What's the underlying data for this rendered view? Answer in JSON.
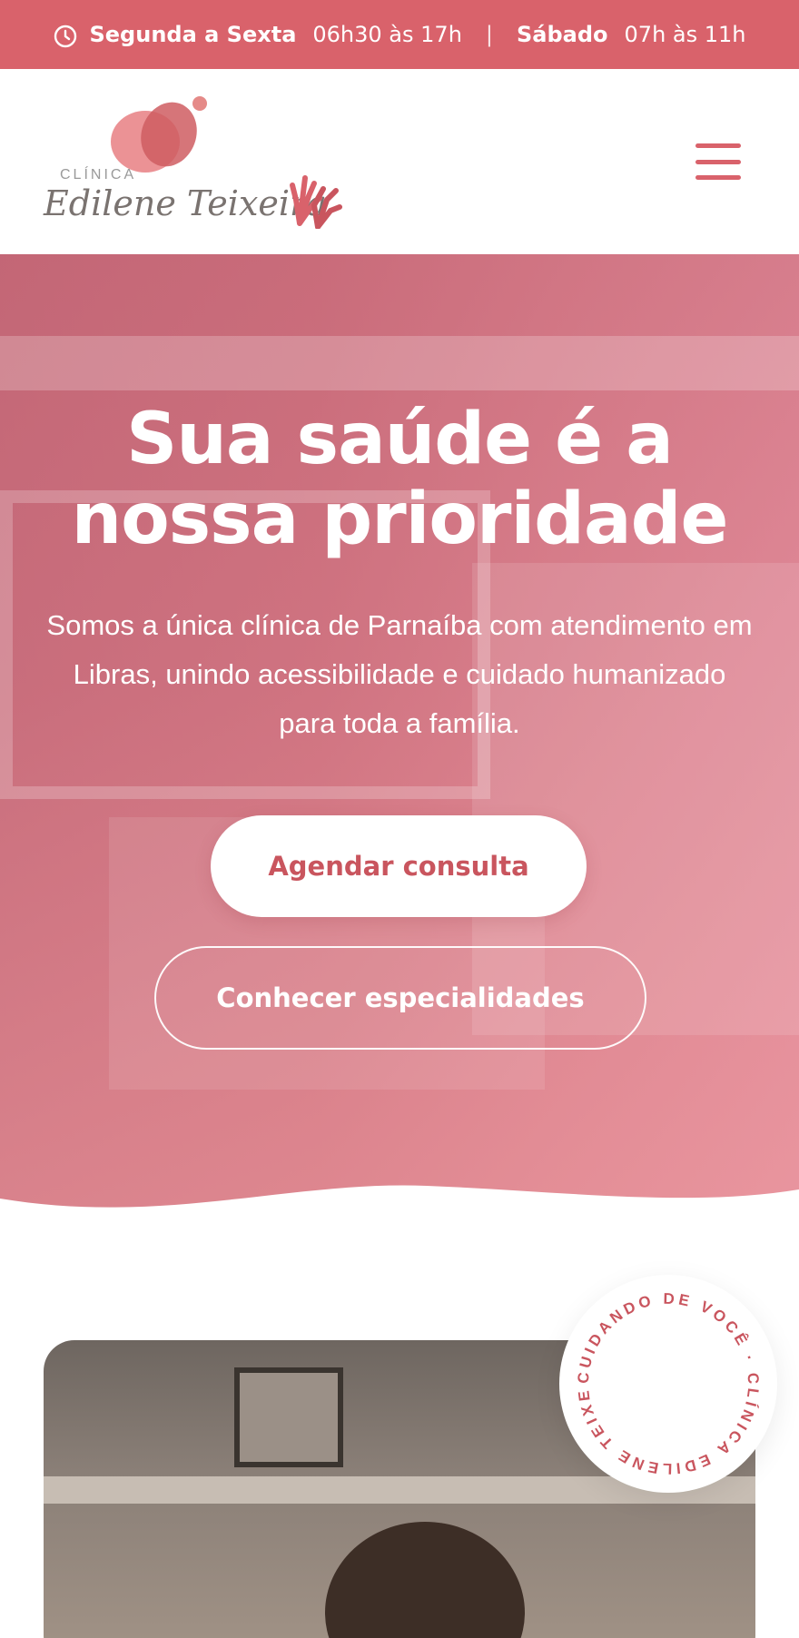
{
  "topbar": {
    "weekdays_label": "Segunda a Sexta",
    "weekdays_hours": "06h30 às 17h",
    "separator": "|",
    "saturday_label": "Sábado",
    "saturday_hours": "07h às 11h",
    "icon": "clock-icon"
  },
  "header": {
    "logo_small": "CLÍNICA",
    "logo_name": "Edilene Teixeira",
    "menu_icon": "hamburger-menu-icon"
  },
  "hero": {
    "title_line1": "Sua saúde é a",
    "title_line2": "nossa prioridade",
    "text": "Somos a única clínica de Parnaíba com atendimento em Libras, unindo acessibilidade e cuidado humanizado para toda a família.",
    "primary_button": "Agendar consulta",
    "secondary_button": "Conhecer especialidades"
  },
  "badge": {
    "circular_text": "CUIDANDO DE VOCÊ · CLÍNICA EDILENE TEIXEIRA · "
  },
  "colors": {
    "brand": "#d9626b",
    "brand_dark": "#c9555e",
    "hero_overlay": "#e07a8c"
  }
}
